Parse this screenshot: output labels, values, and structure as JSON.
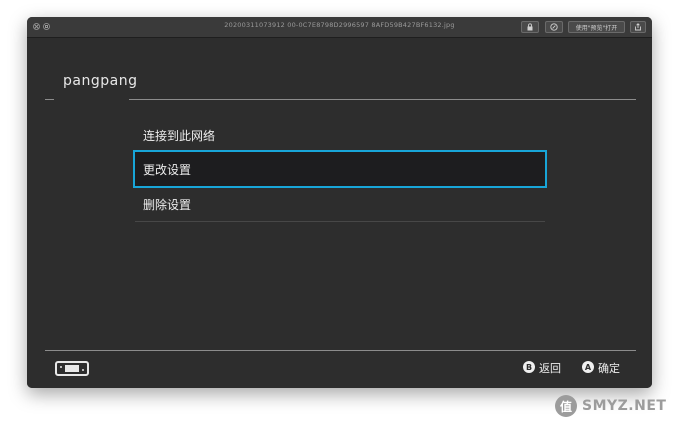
{
  "titlebar": {
    "file_name": "20200311073912 00-0C7E8798D2996597 8AFD59B427BF6132.jpg",
    "open_with_preview_label": "使用\"预览\"打开"
  },
  "profile": {
    "user_name": "pangpang"
  },
  "menu": {
    "items": [
      {
        "label": "连接到此网络",
        "selected": false
      },
      {
        "label": "更改设置",
        "selected": true
      },
      {
        "label": "删除设置",
        "selected": false
      }
    ]
  },
  "footer": {
    "back_button_glyph": "B",
    "back_label": "返回",
    "confirm_button_glyph": "A",
    "confirm_label": "确定"
  },
  "watermark": {
    "logo_glyph": "值",
    "text": "SMYZ.NET"
  },
  "colors": {
    "selection_border": "#18a5d8",
    "background": "#2d2d2d",
    "text": "#ededed"
  },
  "icons": {
    "console": "switch-console-icon",
    "lock": "lock-icon",
    "markup": "markup-icon",
    "share": "share-icon"
  }
}
